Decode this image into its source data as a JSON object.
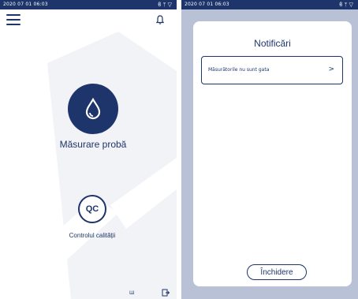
{
  "left_screen": {
    "status_bar": {
      "time": "2020 07 01 06:03",
      "icons": [
        "bluetooth-icon",
        "usb-icon",
        "wifi-icon"
      ]
    },
    "menu_icon": "hamburger-menu-icon",
    "notification_icon": "bell-icon",
    "measure": {
      "icon": "water-drop-icon",
      "label": "Măsurare probă"
    },
    "quality_control": {
      "badge": "QC",
      "label": "Controlul calității"
    },
    "footer": {
      "left_text": "Ш",
      "right_icon": "exit-icon"
    }
  },
  "right_screen": {
    "status_bar": {
      "time": "2020 07 01 06:03",
      "icons": [
        "bluetooth-icon",
        "usb-icon",
        "wifi-icon"
      ]
    },
    "dialog": {
      "title": "Notificări",
      "items": [
        {
          "text": "Măsurătorile nu sunt gata",
          "icon": "chevron-right-icon"
        }
      ],
      "close_label": "Închidere"
    }
  },
  "colors": {
    "primary": "#1e356b",
    "overlay": "#b9c1d6",
    "background_shape": "#f1f3f7",
    "white": "#ffffff"
  }
}
